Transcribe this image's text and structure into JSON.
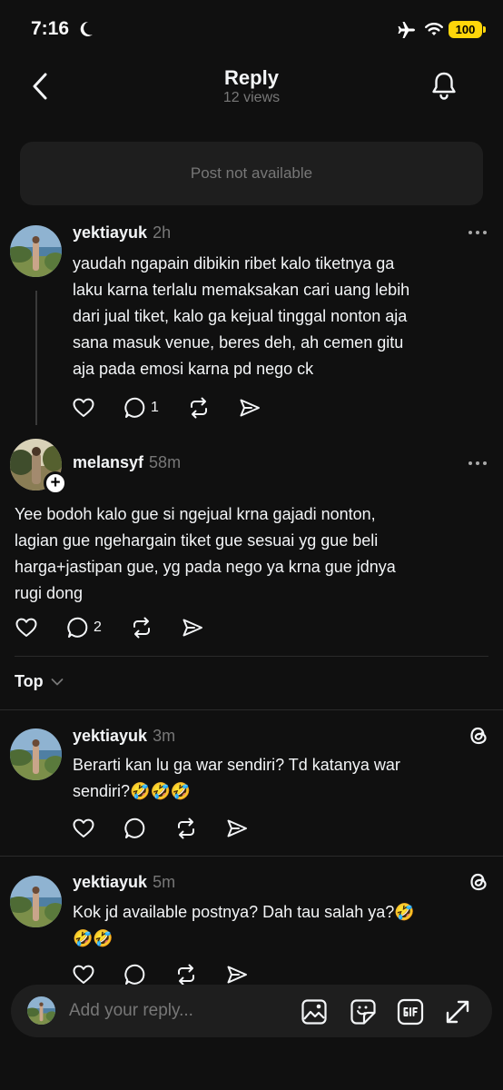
{
  "status_bar": {
    "time": "7:16",
    "battery": "100"
  },
  "nav": {
    "title": "Reply",
    "views": "12 views"
  },
  "post_unavailable": "Post not available",
  "comment1": {
    "username": "yektiayuk",
    "time": "2h",
    "lines": [
      "yaudah ngapain dibikin ribet kalo tiketnya ga",
      "laku karna terlalu memaksakan cari uang lebih",
      "dari jual tiket, kalo ga kejual tinggal nonton aja",
      "sana masuk venue, beres deh, ah cemen gitu",
      "aja pada emosi karna pd nego ck"
    ],
    "reply_count": "1"
  },
  "main_post": {
    "username": "melansyf",
    "time": "58m",
    "plus": "+",
    "lines": [
      "Yee bodoh kalo gue si ngejual krna gajadi nonton,",
      "lagian gue ngehargain tiket gue sesuai yg gue beli",
      "harga+jastipan gue, yg pada nego ya krna gue jdnya",
      "rugi dong"
    ],
    "reply_count": "2"
  },
  "sort": {
    "label": "Top"
  },
  "replies": [
    {
      "username": "yektiayuk",
      "time": "3m",
      "lines": [
        "Berarti kan lu ga war sendiri? Td katanya war",
        "sendiri?🤣🤣🤣"
      ]
    },
    {
      "username": "yektiayuk",
      "time": "5m",
      "lines": [
        "Kok jd available postnya? Dah tau salah ya?🤣",
        "🤣🤣"
      ]
    }
  ],
  "reply_bar": {
    "placeholder": "Add your reply..."
  },
  "icons": {
    "back": "chevron-left-icon",
    "bell": "bell-icon",
    "more": "more-dots-icon",
    "like": "heart-icon",
    "comment": "comment-bubble-icon",
    "repost": "repost-icon",
    "share": "send-icon",
    "threads": "threads-logo-icon",
    "image": "image-icon",
    "sticker": "sticker-icon",
    "gif": "gif-icon",
    "expand": "expand-icon"
  },
  "colors": {
    "background": "#101010",
    "text": "#f3f5f7",
    "muted": "#777777",
    "card": "#1e1e1e",
    "battery": "#ffd60a"
  }
}
